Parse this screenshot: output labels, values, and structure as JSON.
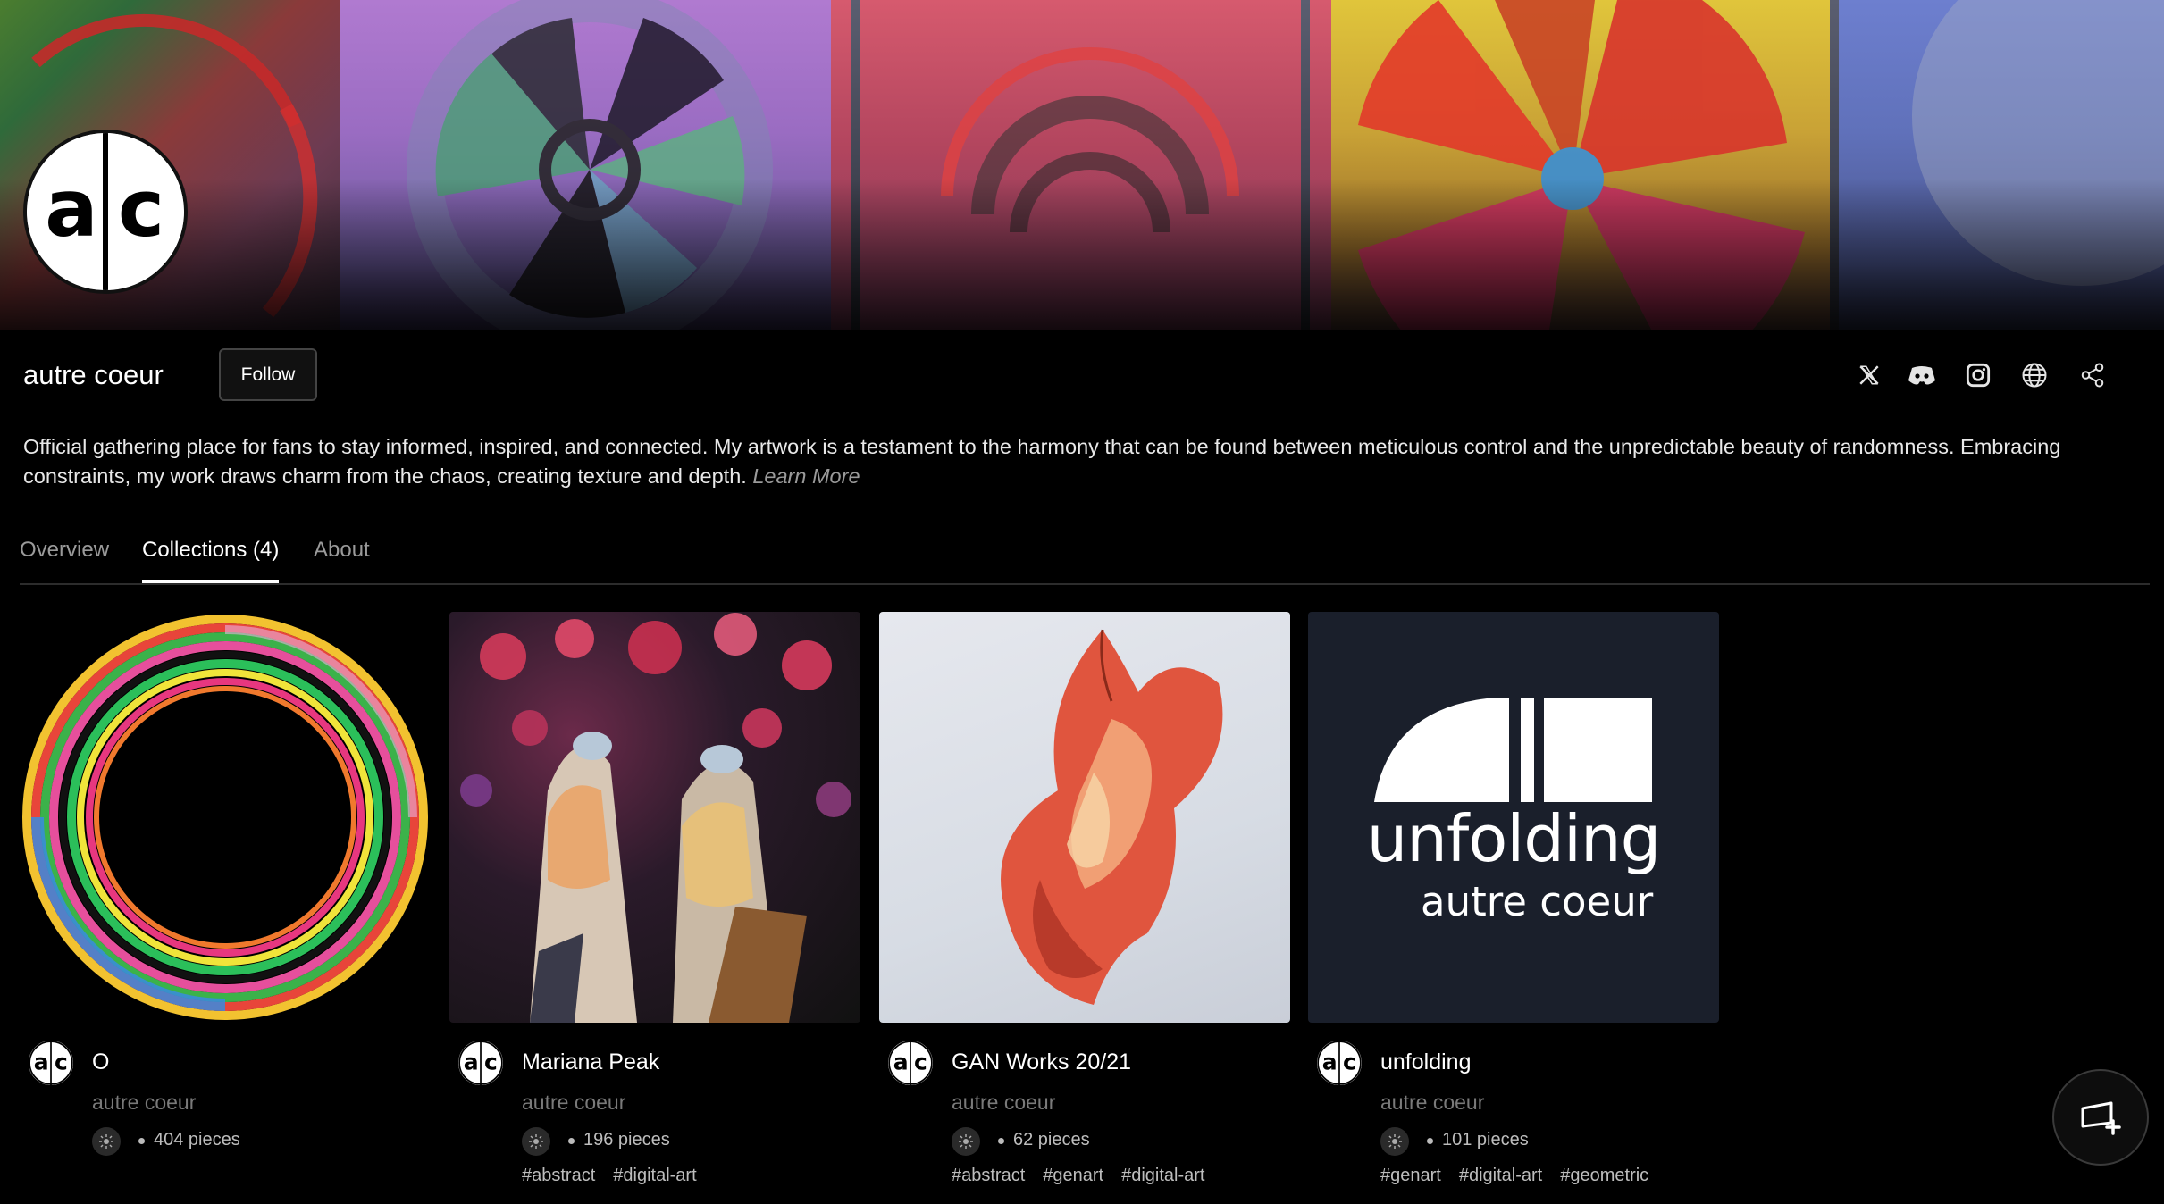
{
  "profile": {
    "name": "autre coeur",
    "follow_label": "Follow",
    "bio": "Official gathering place for fans to stay informed, inspired, and connected. My artwork is a testament to the harmony that can be found between meticulous control and the unpredictable beauty of randomness. Embracing constraints, my work draws charm from the chaos, creating texture and depth.",
    "learn_more": "Learn More",
    "avatar_text": "a|c"
  },
  "social": [
    {
      "name": "x-icon"
    },
    {
      "name": "discord-icon"
    },
    {
      "name": "instagram-icon"
    },
    {
      "name": "globe-icon"
    },
    {
      "name": "share-icon"
    }
  ],
  "tabs": [
    {
      "label": "Overview"
    },
    {
      "label": "Collections (4)"
    },
    {
      "label": "About"
    }
  ],
  "active_tab": "Collections (4)",
  "collections": [
    {
      "title": "O",
      "author": "autre coeur",
      "pieces": "404 pieces",
      "tags": []
    },
    {
      "title": "Mariana Peak",
      "author": "autre coeur",
      "pieces": "196 pieces",
      "tags": [
        "#abstract",
        "#digital-art"
      ]
    },
    {
      "title": "GAN Works 20/21",
      "author": "autre coeur",
      "pieces": "62 pieces",
      "tags": [
        "#abstract",
        "#genart",
        "#digital-art"
      ]
    },
    {
      "title": "unfolding",
      "author": "autre coeur",
      "pieces": "101 pieces",
      "tags": [
        "#genart",
        "#digital-art",
        "#geometric"
      ]
    }
  ],
  "unfolding_cover": {
    "title": "unfolding",
    "subtitle": "autre coeur"
  },
  "colors": {
    "background": "#000000",
    "muted_text": "#7a7a7a",
    "cover_dark": "#1a1f2b"
  }
}
